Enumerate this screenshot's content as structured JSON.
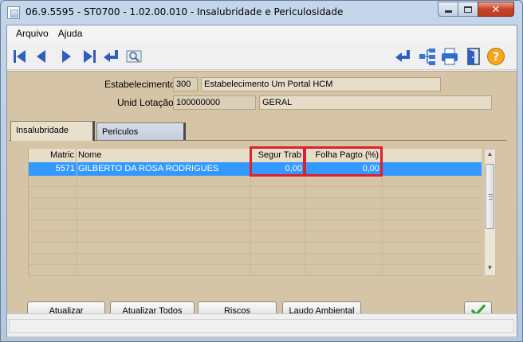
{
  "window": {
    "title": "06.9.5595 - ST0700 - 1.02.00.010 - Insalubridade e Periculosidade"
  },
  "menu": {
    "items": [
      {
        "label": "Arquivo"
      },
      {
        "label": "Ajuda"
      }
    ]
  },
  "toolbar": {
    "left_icons": [
      "first-record-icon",
      "previous-record-icon",
      "next-record-icon",
      "last-record-icon",
      "return-icon",
      "search-icon"
    ],
    "right_icons": [
      "return-icon",
      "tree-icon",
      "print-icon",
      "exit-icon",
      "help-icon"
    ],
    "colors": {
      "nav_blue": "#2e5fbf",
      "help_orange": "#f4a71d"
    }
  },
  "header": {
    "estabelecimento_label": "Estabelecimento:",
    "estabelecimento_code": "300",
    "estabelecimento_name": "Estabelecimento Um Portal HCM",
    "unid_lotacao_label": "Unid Lotação:",
    "unid_lotacao_code": "100000000",
    "unid_lotacao_name": "GERAL"
  },
  "tabs": [
    {
      "label": "Insalubridade",
      "active": true
    },
    {
      "label": "Periculos",
      "active": false
    }
  ],
  "grid": {
    "columns": [
      "Matric",
      "Nome",
      "Segur Trab",
      "Folha Pagto (%)"
    ],
    "rows": [
      {
        "matric": "5571",
        "nome": "GILBERTO DA ROSA RODRIGUES",
        "segur_trab": "0,00",
        "folha_pagto": "0,00",
        "selected": true
      }
    ],
    "highlight_color": "#e0202a",
    "selection_color": "#3399ff"
  },
  "buttons": {
    "atualizar": "Atualizar",
    "atualizar_todos": "Atualizar Todos",
    "riscos": "Riscos",
    "laudo_ambiental": "Laudo Ambiental",
    "ok_icon": "checkmark-icon"
  },
  "theme": {
    "panel_color": "#d6c4a6",
    "title_bar_color": "#bfcfe4"
  }
}
